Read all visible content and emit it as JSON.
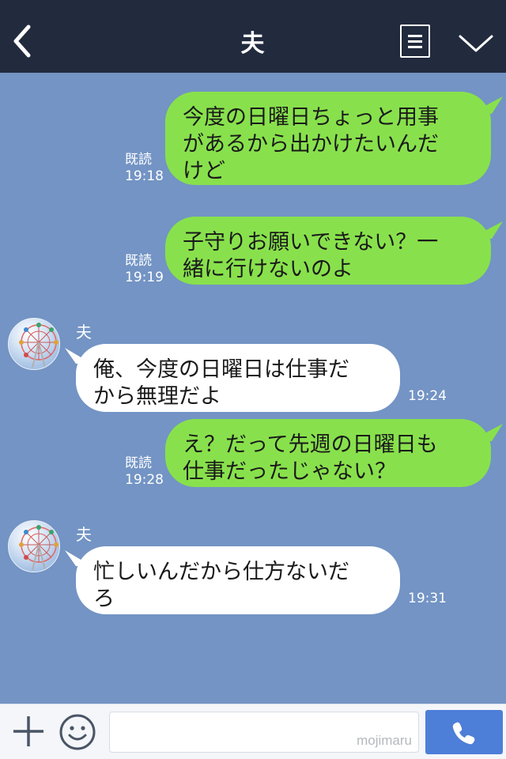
{
  "header": {
    "title": "夫",
    "icons": {
      "back": "chevron-left-icon",
      "menu": "note-list-icon",
      "more": "chevron-down-icon"
    }
  },
  "messages": [
    {
      "side": "right",
      "text_lines": [
        "今度の日曜日ちょっと用事",
        "があるから出かけたいんだ",
        "けど"
      ],
      "read": "既読",
      "time": "19:18"
    },
    {
      "side": "right",
      "text_lines": [
        "子守りお願いできない？一",
        "緒に行けないのよ"
      ],
      "read": "既読",
      "time": "19:19"
    },
    {
      "side": "left",
      "sender": "夫",
      "text_lines": [
        "俺、今度の日曜日は仕事だ",
        "から無理だよ"
      ],
      "time": "19:24"
    },
    {
      "side": "right",
      "text_lines": [
        "え？だって先週の日曜日も",
        "仕事だったじゃない？"
      ],
      "read": "既読",
      "time": "19:28"
    },
    {
      "side": "left",
      "sender": "夫",
      "text_lines": [
        "忙しいんだから仕方ないだ",
        "ろ"
      ],
      "time": "19:31"
    }
  ],
  "footer": {
    "input_value": "",
    "watermark": "mojimaru",
    "icons": {
      "plus": "plus-icon",
      "emoji": "smiley-icon",
      "call": "phone-icon"
    }
  },
  "colors": {
    "header_bg": "#222a3e",
    "chat_bg": "#7394c4",
    "own_bubble": "#88e14c",
    "other_bubble": "#ffffff",
    "call_button": "#4d7ed8"
  }
}
